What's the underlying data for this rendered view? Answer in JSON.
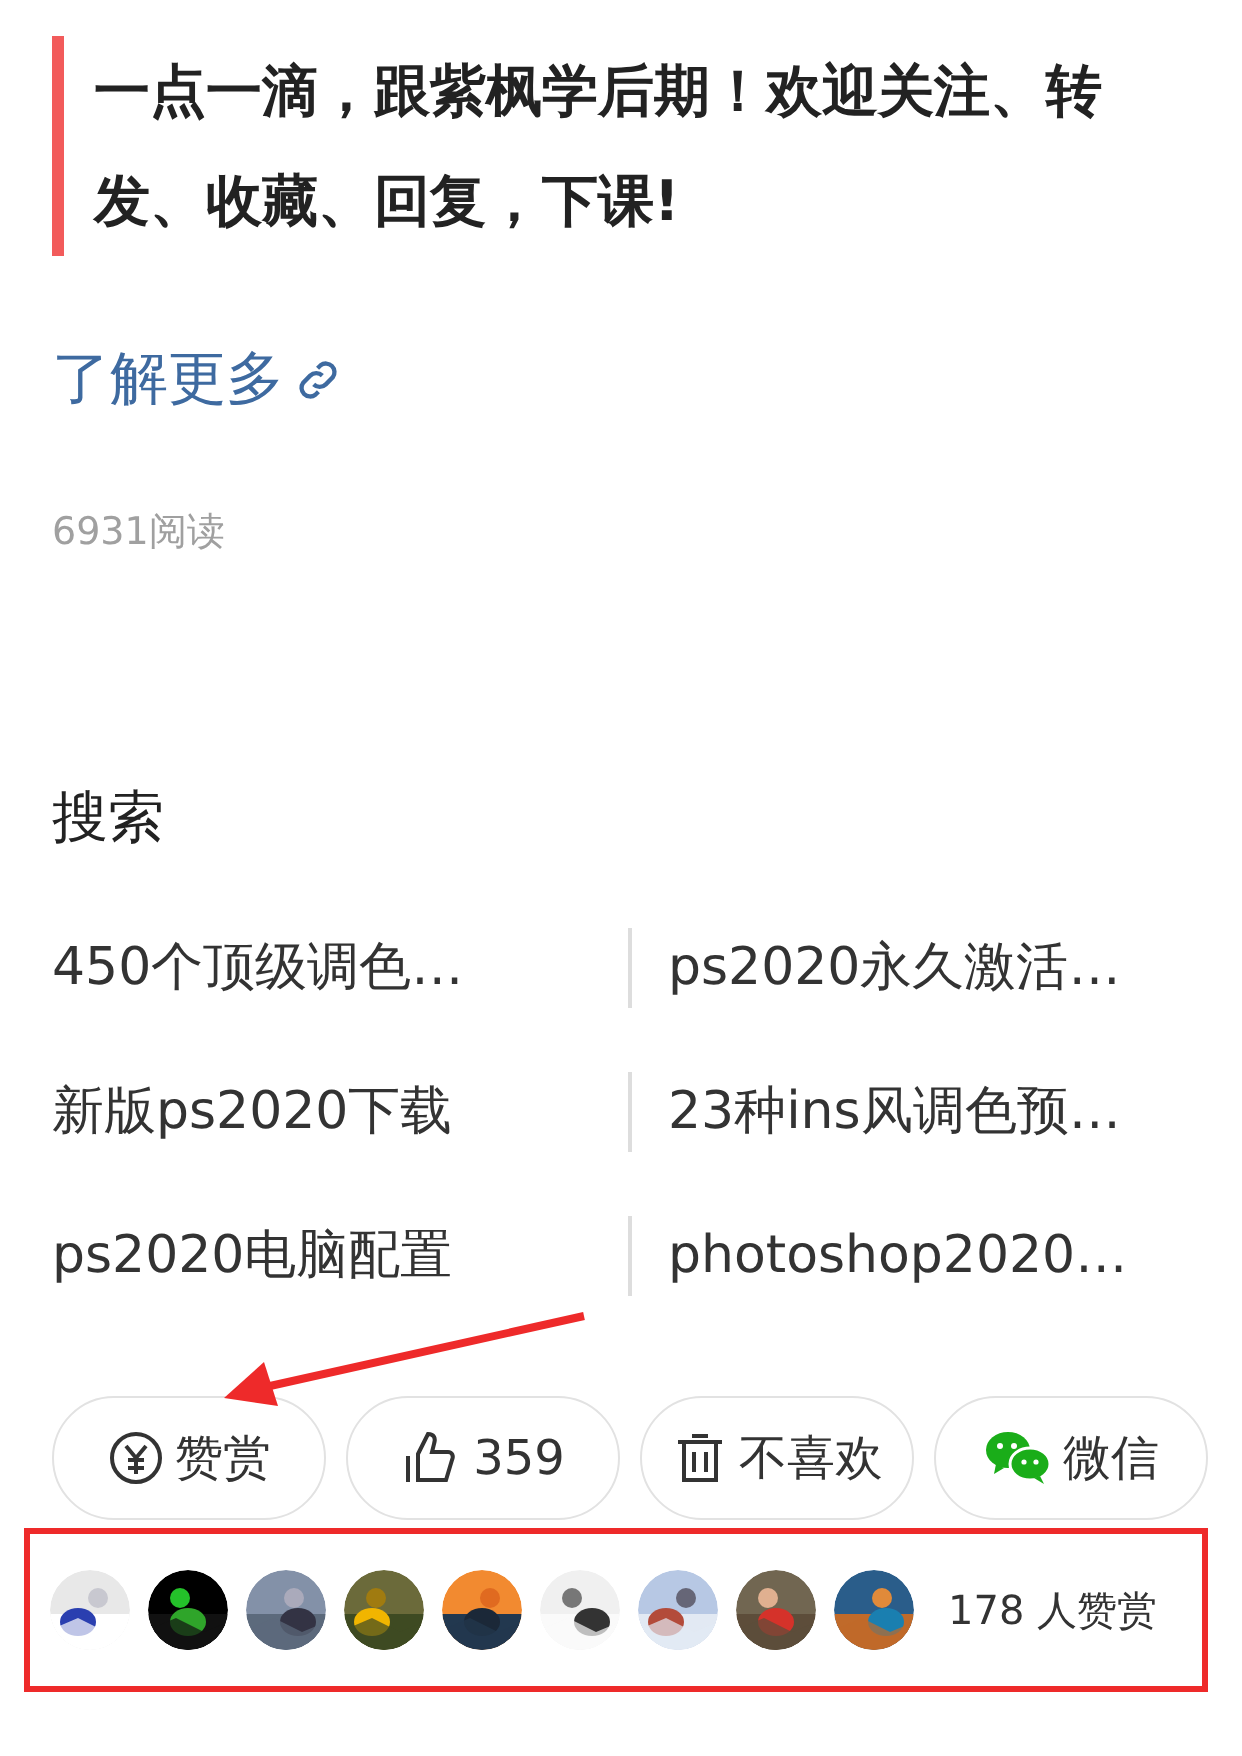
{
  "title": "一点一滴，跟紫枫学后期！欢迎关注、转发、收藏、回复，下课!",
  "more_link": "了解更多",
  "read_count": "6931阅读",
  "search": {
    "heading": "搜索",
    "items": [
      {
        "label": "450个顶级调色…"
      },
      {
        "label": "ps2020永久激活…"
      },
      {
        "label": "新版ps2020下载"
      },
      {
        "label": "23种ins风调色预…"
      },
      {
        "label": "ps2020电脑配置"
      },
      {
        "label": "photoshop2020…"
      }
    ]
  },
  "actions": [
    {
      "kind": "reward",
      "label": "赞赏"
    },
    {
      "kind": "like",
      "label": "359"
    },
    {
      "kind": "dislike",
      "label": "不喜欢"
    },
    {
      "kind": "wechat",
      "label": "微信"
    }
  ],
  "rewards": {
    "count_label": "178 人赞赏"
  }
}
